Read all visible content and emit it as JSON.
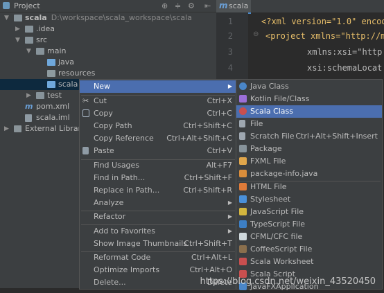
{
  "project_panel": {
    "title": "Project",
    "tree": [
      {
        "label": "scala",
        "path": "D:\\workspace\\scala_workspace\\scala"
      },
      {
        "label": ".idea"
      },
      {
        "label": "src"
      },
      {
        "label": "main"
      },
      {
        "label": "java"
      },
      {
        "label": "resources"
      },
      {
        "label": "scala"
      },
      {
        "label": "test"
      },
      {
        "label": "pom.xml"
      },
      {
        "label": "scala.iml"
      },
      {
        "label": "External Libraries"
      }
    ]
  },
  "editor": {
    "tab_label": "scala",
    "line_numbers": [
      "1",
      "2",
      "3",
      "4"
    ],
    "lines": [
      "<?xml version=\"1.0\" encod",
      "<project xmlns=\"http://ma",
      "xmlns:xsi=\"http",
      "xsi:schemaLocat"
    ]
  },
  "context_menu": {
    "items": [
      {
        "label": "New",
        "shortcut": ""
      },
      {
        "label": "Cut",
        "shortcut": "Ctrl+X"
      },
      {
        "label": "Copy",
        "shortcut": "Ctrl+C"
      },
      {
        "label": "Copy Path",
        "shortcut": "Ctrl+Shift+C"
      },
      {
        "label": "Copy Reference",
        "shortcut": "Ctrl+Alt+Shift+C"
      },
      {
        "label": "Paste",
        "shortcut": "Ctrl+V"
      },
      {
        "label": "Find Usages",
        "shortcut": "Alt+F7"
      },
      {
        "label": "Find in Path...",
        "shortcut": "Ctrl+Shift+F"
      },
      {
        "label": "Replace in Path...",
        "shortcut": "Ctrl+Shift+R"
      },
      {
        "label": "Analyze",
        "shortcut": ""
      },
      {
        "label": "Refactor",
        "shortcut": ""
      },
      {
        "label": "Add to Favorites",
        "shortcut": ""
      },
      {
        "label": "Show Image Thumbnails",
        "shortcut": "Ctrl+Shift+T"
      },
      {
        "label": "Reformat Code",
        "shortcut": "Ctrl+Alt+L"
      },
      {
        "label": "Optimize Imports",
        "shortcut": "Ctrl+Alt+O"
      },
      {
        "label": "Delete...",
        "shortcut": "Delete"
      }
    ]
  },
  "submenu": {
    "items": [
      {
        "label": "Java Class",
        "shortcut": "",
        "icon_color": "#4a86c8"
      },
      {
        "label": "Kotlin File/Class",
        "shortcut": "",
        "icon_color": "#9b6fd8"
      },
      {
        "label": "Scala Class",
        "shortcut": "",
        "icon_color": "#c94f4f"
      },
      {
        "label": "File",
        "shortcut": "",
        "icon_color": "#9ea7b0"
      },
      {
        "label": "Scratch File",
        "shortcut": "Ctrl+Alt+Shift+Insert",
        "icon_color": "#9ea7b0"
      },
      {
        "label": "Package",
        "shortcut": "",
        "icon_color": "#87939a"
      },
      {
        "label": "FXML File",
        "shortcut": "",
        "icon_color": "#e0a64b"
      },
      {
        "label": "package-info.java",
        "shortcut": "",
        "icon_color": "#d98d3b"
      },
      {
        "label": "HTML File",
        "shortcut": "",
        "icon_color": "#e07b39"
      },
      {
        "label": "Stylesheet",
        "shortcut": "",
        "icon_color": "#4a90d9"
      },
      {
        "label": "JavaScript File",
        "shortcut": "",
        "icon_color": "#d4b63e"
      },
      {
        "label": "TypeScript File",
        "shortcut": "",
        "icon_color": "#3d7fc4"
      },
      {
        "label": "CFML/CFC file",
        "shortcut": "",
        "icon_color": "#cfd8dc"
      },
      {
        "label": "CoffeeScript File",
        "shortcut": "",
        "icon_color": "#8a6f4d"
      },
      {
        "label": "Scala Worksheet",
        "shortcut": "",
        "icon_color": "#c94f4f"
      },
      {
        "label": "Scala Script",
        "shortcut": "",
        "icon_color": "#c94f4f"
      },
      {
        "label": "JavaFXApplication",
        "shortcut": "",
        "icon_color": "#4a86c8"
      }
    ]
  },
  "watermark": "https://blog.csdn.net/weixin_43520450"
}
